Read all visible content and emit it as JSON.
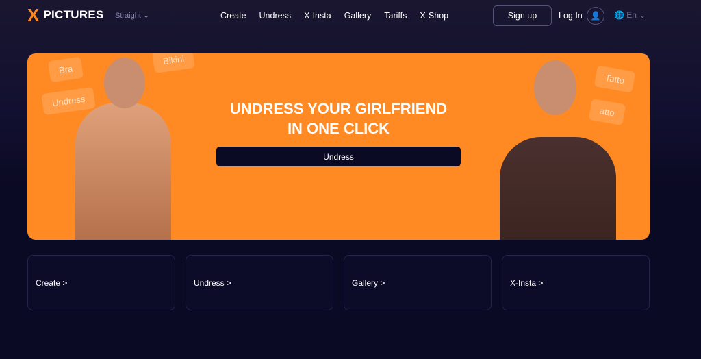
{
  "header": {
    "logo_text": "PICTURES",
    "logo_mark": "X",
    "orientation": "Straight",
    "nav": [
      "Create",
      "Undress",
      "X-Insta",
      "Gallery",
      "Tariffs",
      "X-Shop"
    ],
    "signup": "Sign up",
    "login": "Log In",
    "language": "En"
  },
  "banner": {
    "chips": [
      "Bra",
      "Undress",
      "Bikini",
      "Tatto",
      "atto"
    ],
    "headline_line1": "UNDRESS YOUR GIRLFRIEND",
    "headline_line2": "IN ONE CLICK",
    "cta": "Undress",
    "accent": "#ff8a24"
  },
  "cards": [
    "Create >",
    "Undress >",
    "Gallery >",
    "X-Insta >"
  ]
}
